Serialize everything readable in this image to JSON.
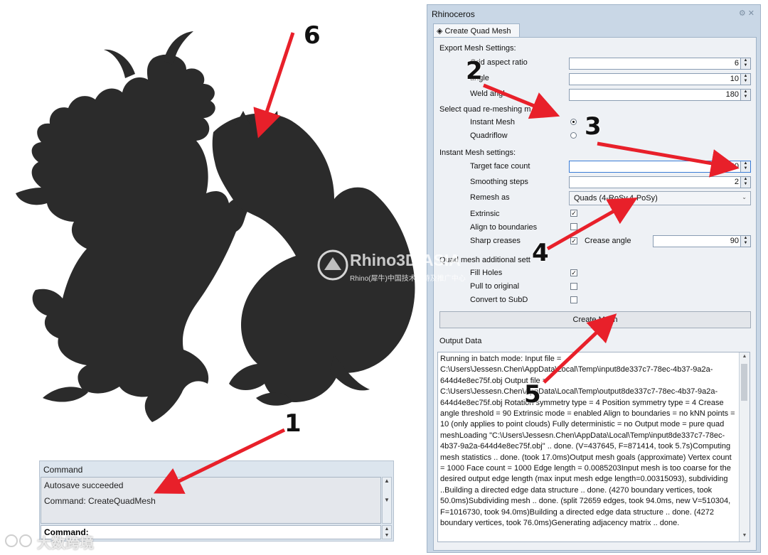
{
  "window": {
    "title": "Rhinoceros",
    "tab_label": "Create Quad Mesh"
  },
  "export_mesh": {
    "header": "Export Mesh Settings:",
    "grid_aspect_label": "Grid aspect ratio",
    "grid_aspect_value": "6",
    "angle_label": "angle",
    "angle_value": "10",
    "weld_label": "Weld angl",
    "weld_value": "180"
  },
  "method": {
    "header": "Select quad re-meshing m",
    "instant_label": "Instant Mesh",
    "instant_selected": true,
    "quadriflow_label": "Quadriflow"
  },
  "instant": {
    "header": "Instant Mesh settings:",
    "target_label": "Target face count",
    "target_value": "4000",
    "smoothing_label": "Smoothing steps",
    "smoothing_value": "2",
    "remesh_label": "Remesh as",
    "remesh_value": "Quads (4-RoSy,4-PoSy)",
    "extrinsic_label": "Extrinsic",
    "extrinsic_checked": true,
    "align_label": "Align to boundaries",
    "align_checked": false,
    "sharp_label": "Sharp creases",
    "sharp_checked": true,
    "crease_label": "Crease angle",
    "crease_value": "90"
  },
  "quad_additional": {
    "header": "Quad mesh additional sett",
    "fill_label": "Fill Holes",
    "fill_checked": true,
    "pull_label": "Pull to original",
    "pull_checked": false,
    "subd_label": "Convert to SubD",
    "subd_checked": false
  },
  "create_button": "Create Mesh",
  "output": {
    "header": "Output Data",
    "text": "Running in batch mode:   Input file            = C:\\Users\\Jessesn.Chen\\AppData\\Local\\Temp\\input8de337c7-78ec-4b37-9a2a-644d4e8ec75f.obj   Output file         = C:\\Users\\Jessesn.Chen\\AppData\\Local\\Temp\\output8de337c7-78ec-4b37-9a2a-644d4e8ec75f.obj   Rotation symmetry type = 4   Position symmetry type = 4   Crease angle threshold = 90   Extrinsic mode = enabled   Align to boundaries    = no   kNN points            = 10 (only applies to point clouds)   Fully deterministic    = no   Output mode           = pure quad meshLoading \"C:\\Users\\Jessesn.Chen\\AppData\\Local\\Temp\\input8de337c7-78ec-4b37-9a2a-644d4e8ec75f.obj\" .. done. (V=437645, F=871414, took 5.7s)Computing mesh statistics .. done. (took 17.0ms)Output mesh goals (approximate)   Vertex count           = 1000   Face count            = 1000   Edge length           = 0.0085203Input mesh is too coarse for the desired output edge length (max input mesh edge length=0.00315093), subdividing ..Building a directed edge data structure .. done. (4270 boundary vertices, took 50.0ms)Subdividing mesh .. done. (split 72659 edges, took 94.0ms, new V=510304, F=1016730, took 94.0ms)Building a directed edge data structure .. done. (4272 boundary vertices, took 76.0ms)Generating adjacency matrix .. done."
  },
  "command_panel": {
    "title": "Command",
    "line1": "Autosave succeeded",
    "line2": "Command: CreateQuadMesh",
    "prompt": "Command:"
  },
  "annotations": [
    "1",
    "2",
    "3",
    "4",
    "5",
    "6"
  ],
  "watermark": {
    "main": "Rhino3D.ASIA",
    "sub": "Rhino(犀牛)中国技术支持及推广中心",
    "bottom": "大数跨境"
  },
  "colors": {
    "dragon": "#2b2b2b",
    "arrow": "#e8202a",
    "panel_bg": "#c9d7e6"
  }
}
